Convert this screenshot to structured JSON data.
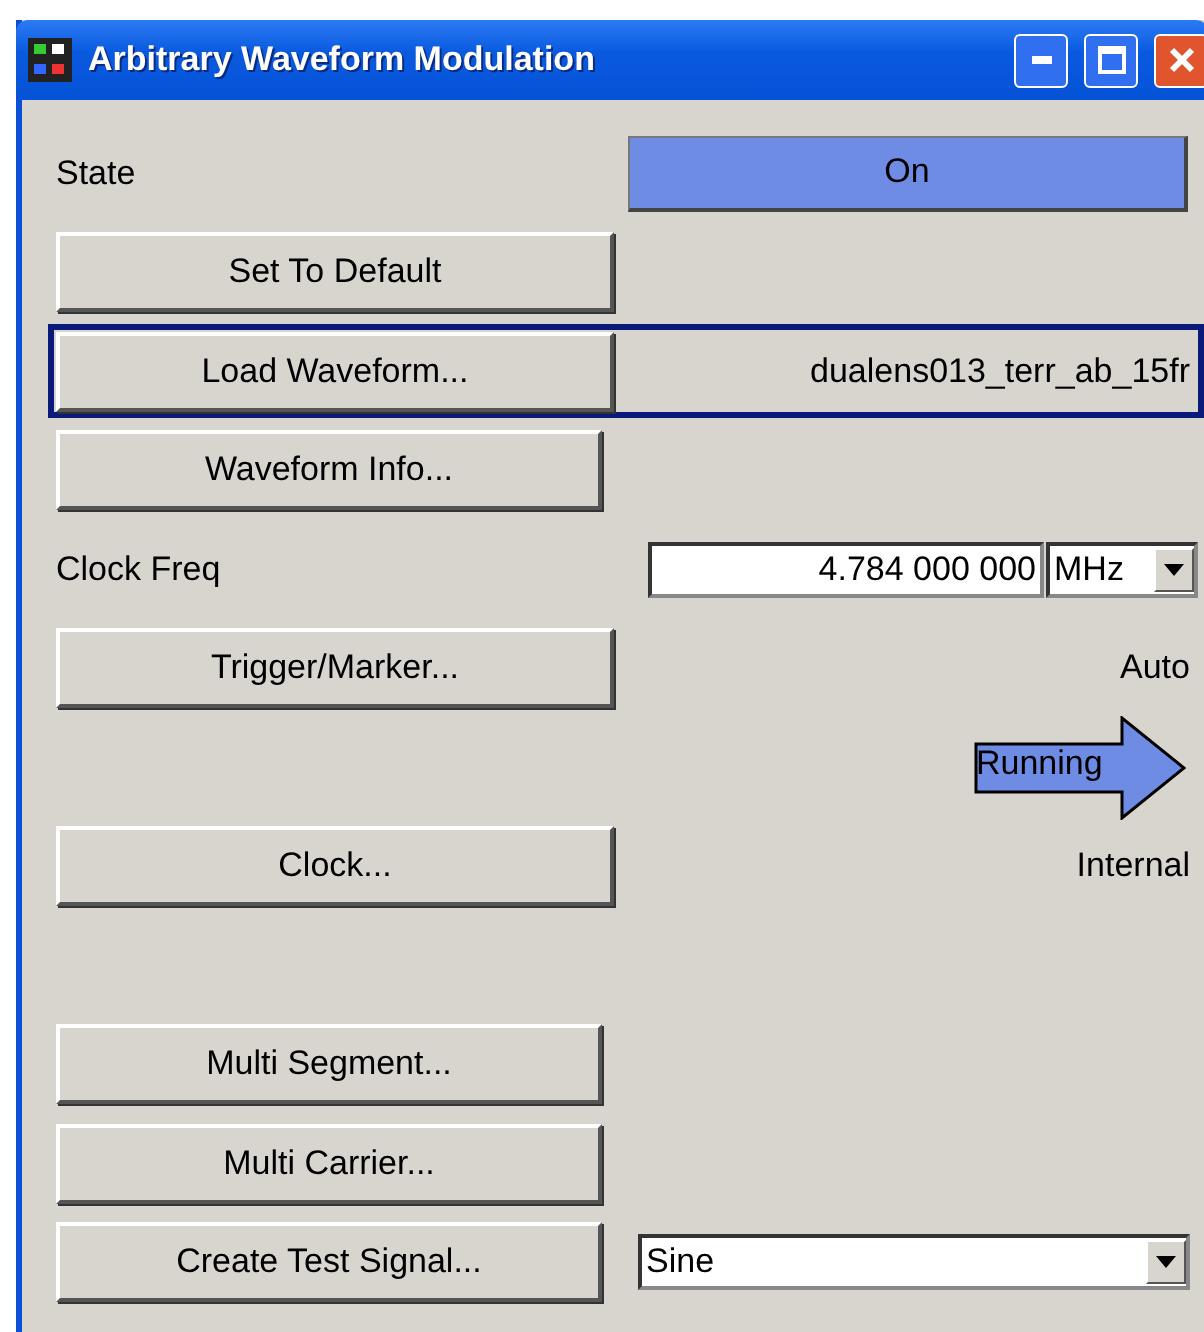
{
  "window": {
    "title": "Arbitrary Waveform Modulation"
  },
  "rows": [
    {
      "kind": "state",
      "label": "State",
      "value": "On",
      "on": true
    },
    {
      "kind": "button",
      "label": "Set To Default"
    },
    {
      "kind": "button-value",
      "label": "Load Waveform...",
      "value": "dualens013_terr_ab_15fr",
      "focused": true
    },
    {
      "kind": "button",
      "label": "Waveform Info..."
    },
    {
      "kind": "freq",
      "label": "Clock Freq",
      "value": "4.784 000 000",
      "unit": "MHz"
    },
    {
      "kind": "button-value",
      "label": "Trigger/Marker...",
      "value": "Auto",
      "focused": false
    },
    {
      "kind": "status",
      "value": "Running"
    },
    {
      "kind": "button-value",
      "label": "Clock...",
      "value": "Internal",
      "focused": false
    },
    {
      "kind": "blank"
    },
    {
      "kind": "button",
      "label": "Multi Segment..."
    },
    {
      "kind": "button",
      "label": "Multi Carrier..."
    },
    {
      "kind": "button-select",
      "label": "Create Test Signal...",
      "value": "Sine"
    }
  ]
}
